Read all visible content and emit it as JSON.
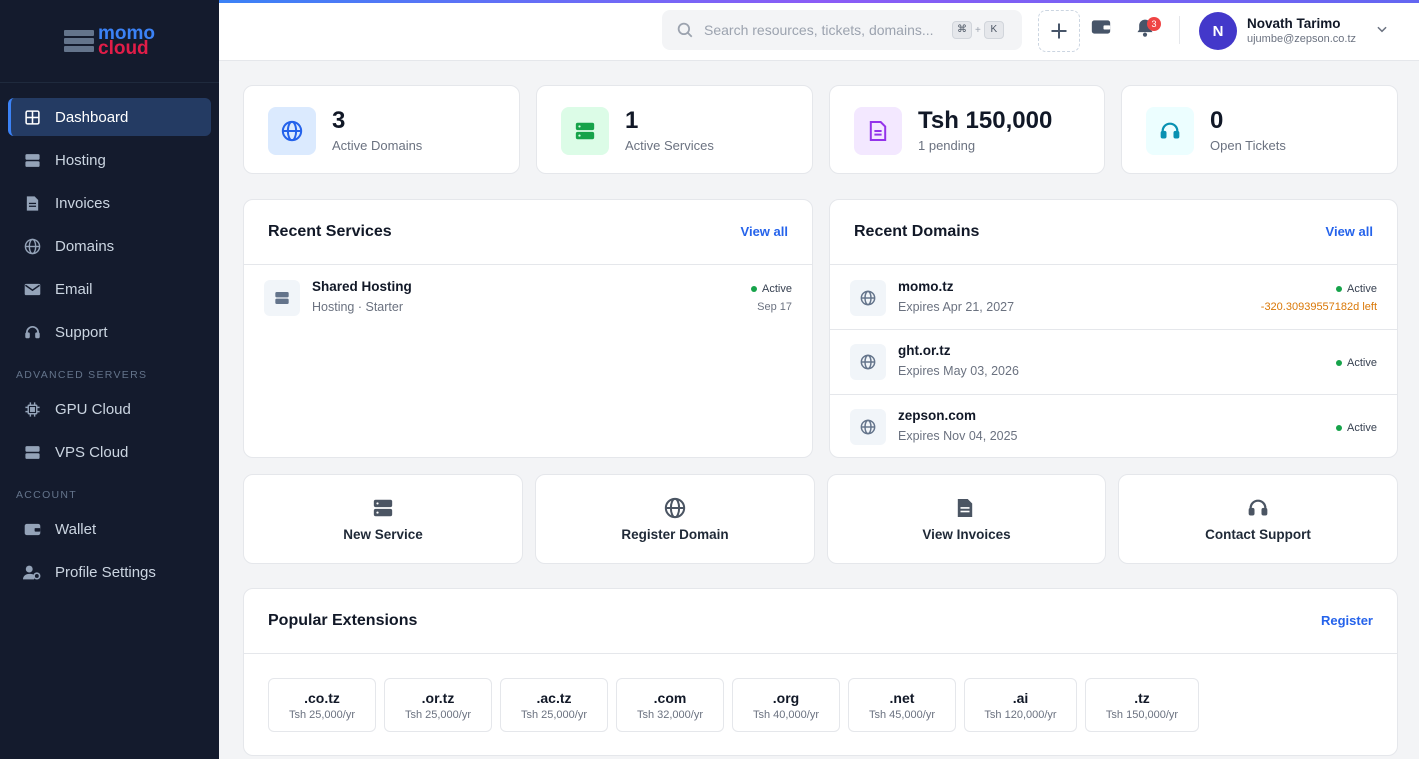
{
  "brand": {
    "line1": "momo",
    "line2": "cloud"
  },
  "sidebar": {
    "items": [
      {
        "label": "Dashboard",
        "icon": "grid-icon"
      },
      {
        "label": "Hosting",
        "icon": "server-icon"
      },
      {
        "label": "Invoices",
        "icon": "file-icon"
      },
      {
        "label": "Domains",
        "icon": "globe-icon"
      },
      {
        "label": "Email",
        "icon": "mail-icon"
      },
      {
        "label": "Support",
        "icon": "headset-icon"
      }
    ],
    "section_advanced": "ADVANCED SERVERS",
    "advanced_items": [
      {
        "label": "GPU Cloud",
        "icon": "chip-icon"
      },
      {
        "label": "VPS Cloud",
        "icon": "server-icon"
      }
    ],
    "section_account": "ACCOUNT",
    "account_items": [
      {
        "label": "Wallet",
        "icon": "wallet-icon"
      },
      {
        "label": "Profile Settings",
        "icon": "user-cog-icon"
      }
    ]
  },
  "header": {
    "search_placeholder": "Search resources, tickets, domains...",
    "shortcut_key1": "⌘",
    "shortcut_plus": "+",
    "shortcut_key2": "K",
    "notification_count": "3",
    "user": {
      "initial": "N",
      "name": "Novath Tarimo",
      "email": "ujumbe@zepson.co.tz"
    }
  },
  "stats": [
    {
      "value": "3",
      "label": "Active Domains",
      "icon": "globe-icon",
      "color": "#2563eb",
      "bg": "#dbeafe"
    },
    {
      "value": "1",
      "label": "Active Services",
      "icon": "server-icon",
      "color": "#16a34a",
      "bg": "#dcfce7"
    },
    {
      "value": "Tsh 150,000",
      "label": "1 pending",
      "icon": "file-icon",
      "color": "#9333ea",
      "bg": "#f3e8ff"
    },
    {
      "value": "0",
      "label": "Open Tickets",
      "icon": "headset-icon",
      "color": "#0891b2",
      "bg": "#ecfeff"
    }
  ],
  "recent_services": {
    "title": "Recent Services",
    "view_all": "View all",
    "items": [
      {
        "name": "Shared Hosting",
        "detail": "Hosting · Starter",
        "status": "Active",
        "date": "Sep 17"
      }
    ]
  },
  "recent_domains": {
    "title": "Recent Domains",
    "view_all": "View all",
    "items": [
      {
        "name": "momo.tz",
        "expires": "Expires Apr 21, 2027",
        "status": "Active",
        "note": "-320.30939557182d left"
      },
      {
        "name": "ght.or.tz",
        "expires": "Expires May 03, 2026",
        "status": "Active"
      },
      {
        "name": "zepson.com",
        "expires": "Expires Nov 04, 2025",
        "status": "Active"
      }
    ]
  },
  "quick_actions": [
    {
      "label": "New Service",
      "icon": "server-icon"
    },
    {
      "label": "Register Domain",
      "icon": "globe-icon"
    },
    {
      "label": "View Invoices",
      "icon": "file-icon"
    },
    {
      "label": "Contact Support",
      "icon": "headset-icon"
    }
  ],
  "popular_extensions": {
    "title": "Popular Extensions",
    "action": "Register",
    "items": [
      {
        "ext": ".co.tz",
        "price": "Tsh 25,000/yr"
      },
      {
        "ext": ".or.tz",
        "price": "Tsh 25,000/yr"
      },
      {
        "ext": ".ac.tz",
        "price": "Tsh 25,000/yr"
      },
      {
        "ext": ".com",
        "price": "Tsh 32,000/yr"
      },
      {
        "ext": ".org",
        "price": "Tsh 40,000/yr"
      },
      {
        "ext": ".net",
        "price": "Tsh 45,000/yr"
      },
      {
        "ext": ".ai",
        "price": "Tsh 120,000/yr"
      },
      {
        "ext": ".tz",
        "price": "Tsh 150,000/yr"
      }
    ]
  }
}
